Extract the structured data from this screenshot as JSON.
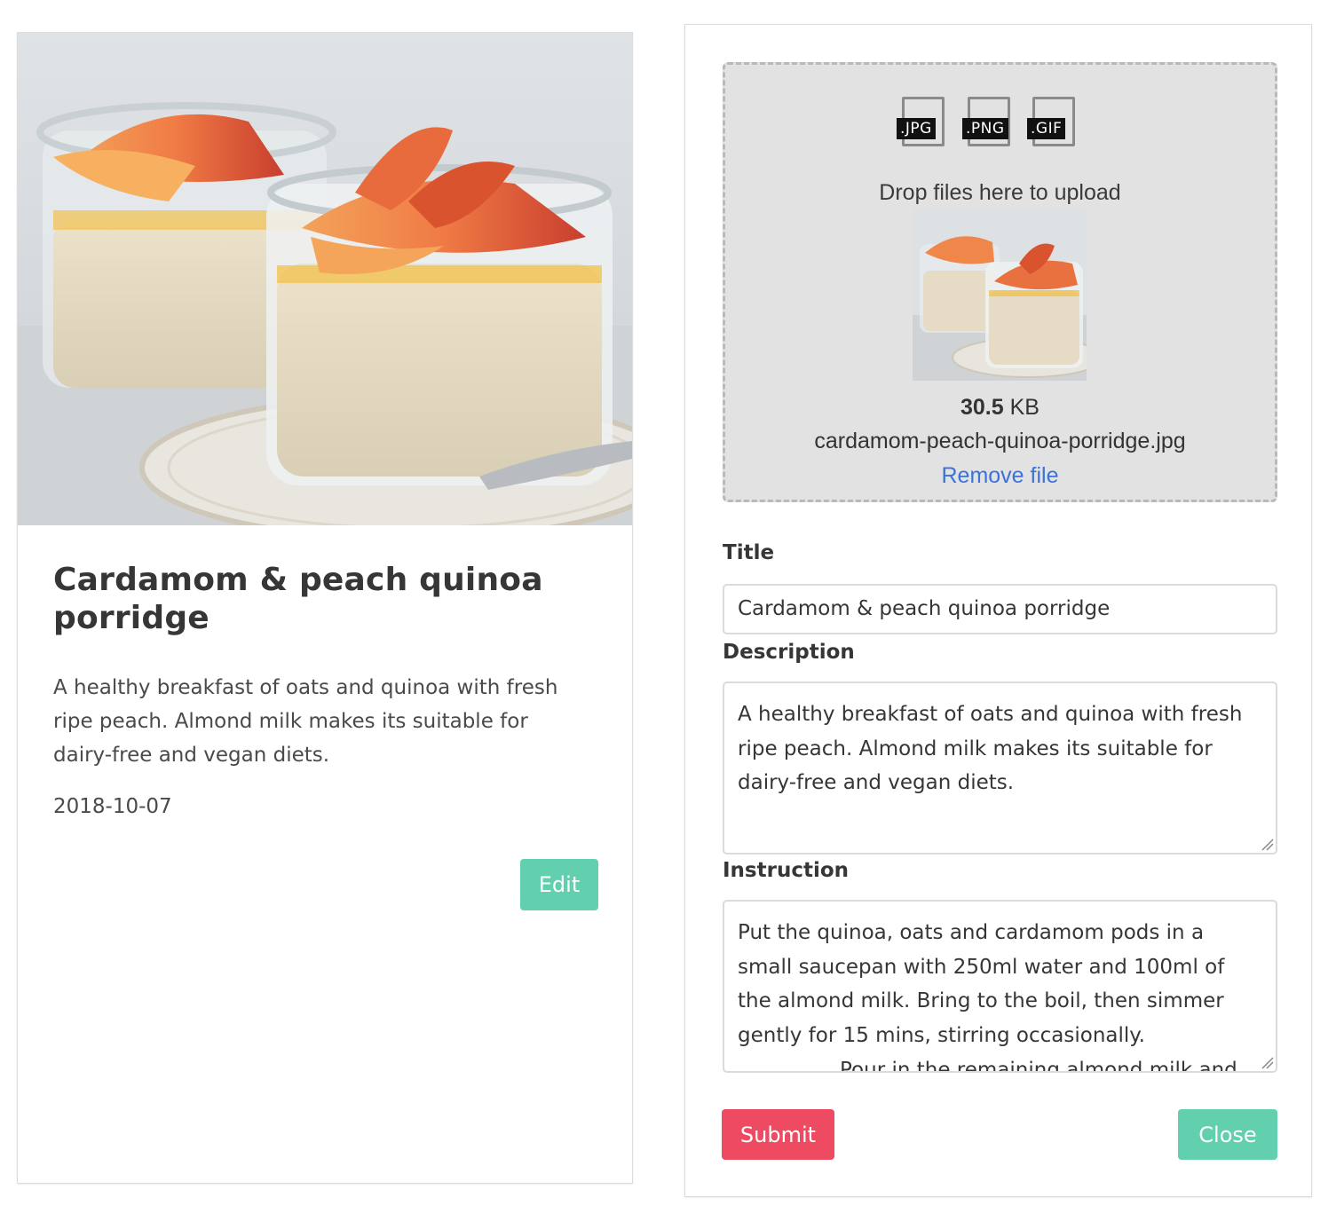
{
  "card": {
    "image_alt": "Cardamom & peach quinoa porridge photo",
    "title": "Cardamom & peach quinoa porridge",
    "description": "A healthy breakfast of oats and quinoa with fresh ripe peach. Almond milk makes its suitable for dairy-free and vegan diets.",
    "date": "2018-10-07",
    "edit_label": "Edit"
  },
  "upload": {
    "file_types": [
      ".JPG",
      ".PNG",
      ".GIF"
    ],
    "drop_text": "Drop files here to upload",
    "file_size_value": "30.5",
    "file_size_unit": "KB",
    "file_name": "cardamom-peach-quinoa-porridge.jpg",
    "remove_label": "Remove file"
  },
  "form": {
    "title_label": "Title",
    "title_value": "Cardamom & peach quinoa porridge",
    "description_label": "Description",
    "description_value": "A healthy breakfast of oats and quinoa with fresh ripe peach. Almond milk makes its suitable for dairy-free and vegan diets.",
    "instruction_label": "Instruction",
    "instruction_value": "Put the quinoa, oats and cardamom pods in a small saucepan with 250ml water and 100ml of the almond milk. Bring to the boil, then simmer gently for 15 mins, stirring occasionally.",
    "instruction_value_2": "Pour in the remaining almond milk and",
    "submit_label": "Submit",
    "close_label": "Close"
  },
  "colors": {
    "primary": "#62cfaf",
    "danger": "#ee4a62",
    "link": "#3b73d9",
    "dropzone_bg": "#e2e2e2"
  }
}
